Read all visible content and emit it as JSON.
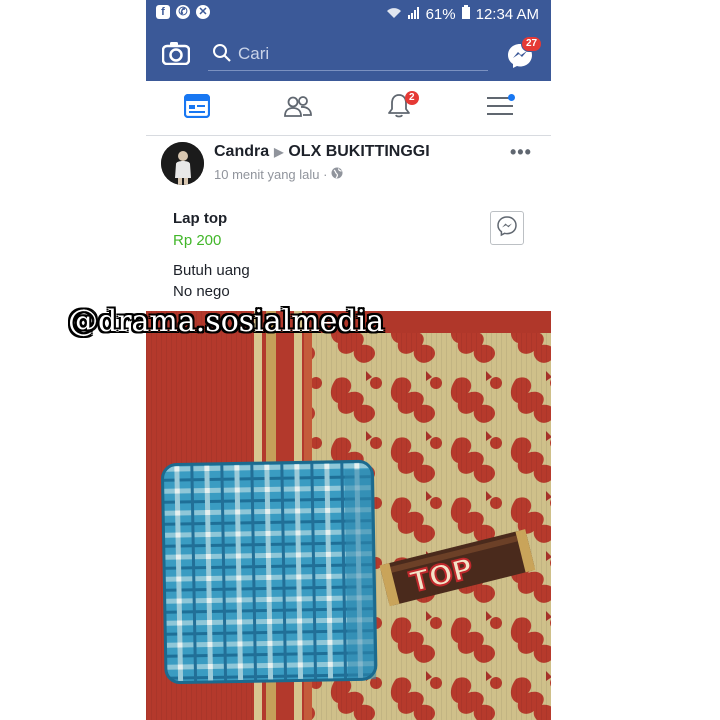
{
  "status_bar": {
    "left_icons": [
      "facebook-icon",
      "whatsapp-icon",
      "app-icon"
    ],
    "battery": "61%",
    "time": "12:34 AM"
  },
  "header": {
    "search_placeholder": "Cari",
    "messenger_badge": "27"
  },
  "tabs": [
    {
      "name": "news-feed",
      "icon": "feed-icon"
    },
    {
      "name": "friends",
      "icon": "friends-icon"
    },
    {
      "name": "notifications",
      "icon": "bell-icon",
      "badge": "2"
    },
    {
      "name": "menu",
      "icon": "hamburger-icon"
    }
  ],
  "post": {
    "author": "Candra",
    "group": "OLX BUKITTINGGI",
    "time": "10 menit yang lalu ·",
    "item_title": "Lap top",
    "item_price": "Rp 200",
    "description": [
      "Butuh uang",
      "No nego"
    ]
  },
  "watermark": "@drama.sosialmedia",
  "colors": {
    "facebook_blue": "#3b5998",
    "price_green": "#42b72a",
    "badge_red": "#e53935"
  }
}
